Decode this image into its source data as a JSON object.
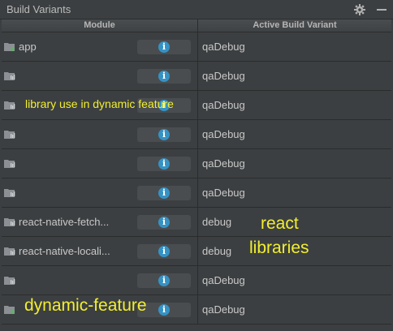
{
  "panel": {
    "title": "Build Variants"
  },
  "table": {
    "headers": {
      "module": "Module",
      "variant": "Active Build Variant"
    },
    "rows": [
      {
        "module": "app",
        "icon": "app-module-icon",
        "variant": "qaDebug"
      },
      {
        "module": "",
        "icon": "library-module-icon",
        "variant": "qaDebug"
      },
      {
        "module": "",
        "icon": "library-module-icon",
        "variant": "qaDebug"
      },
      {
        "module": "",
        "icon": "library-module-icon",
        "variant": "qaDebug"
      },
      {
        "module": "",
        "icon": "library-module-icon",
        "variant": "qaDebug"
      },
      {
        "module": "",
        "icon": "library-module-icon",
        "variant": "qaDebug"
      },
      {
        "module": "react-native-fetch...",
        "icon": "library-module-icon",
        "variant": "debug"
      },
      {
        "module": "react-native-locali...",
        "icon": "library-module-icon",
        "variant": "debug"
      },
      {
        "module": "",
        "icon": "library-module-icon",
        "variant": "qaDebug"
      },
      {
        "module": "",
        "icon": "dynamic-feature-module-icon",
        "variant": "qaDebug"
      }
    ]
  },
  "annotations": {
    "library": "library use in dynamic feature",
    "react_line1": "react",
    "react_line2": "libraries",
    "dynamic": "dynamic-feature"
  },
  "colors": {
    "background": "#3c3f41",
    "info_icon": "#3592c4",
    "annotation": "#f2ef2f",
    "app_badge": "#6aab73"
  }
}
